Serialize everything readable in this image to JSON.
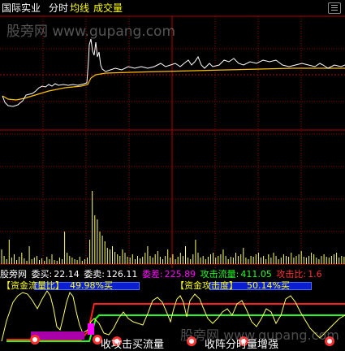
{
  "header": {
    "stock_name": "国际实业",
    "tab_intraday": "分时",
    "legend_avg": "均线",
    "legend_volume": "成交量"
  },
  "watermark": {
    "text": "股旁网 www.gupang.com"
  },
  "info_bar": {
    "site": "股旁网",
    "bid_label": "委买:",
    "bid_value": "22.14",
    "ask_label": "委卖:",
    "ask_value": "126.11",
    "diff_label": "委差:",
    "diff_value": "225.89",
    "attack_flow_label": "攻击流量:",
    "attack_flow_value": "411.05",
    "attack_ratio_label": "攻击比:",
    "attack_ratio_value": "1.6"
  },
  "lower_panel": {
    "capital_flow_label": "【资金流量比】",
    "capital_flow_value": "49.98%买",
    "capital_attack_label": "【资金攻击度】",
    "capital_attack_value": "50.14%买"
  },
  "bottom_text": {
    "left": "收攻击买流量",
    "right": "收阵分时量增强"
  },
  "colors": {
    "grid": "#8b0000",
    "price_line": "#ffffff",
    "avg_line": "#ffc000",
    "volume_bar": "#ffff66",
    "red_level": "#ff2020",
    "green_level": "#20ff20",
    "yellow_line": "#ffff66",
    "magenta": "#ff00ff"
  }
}
